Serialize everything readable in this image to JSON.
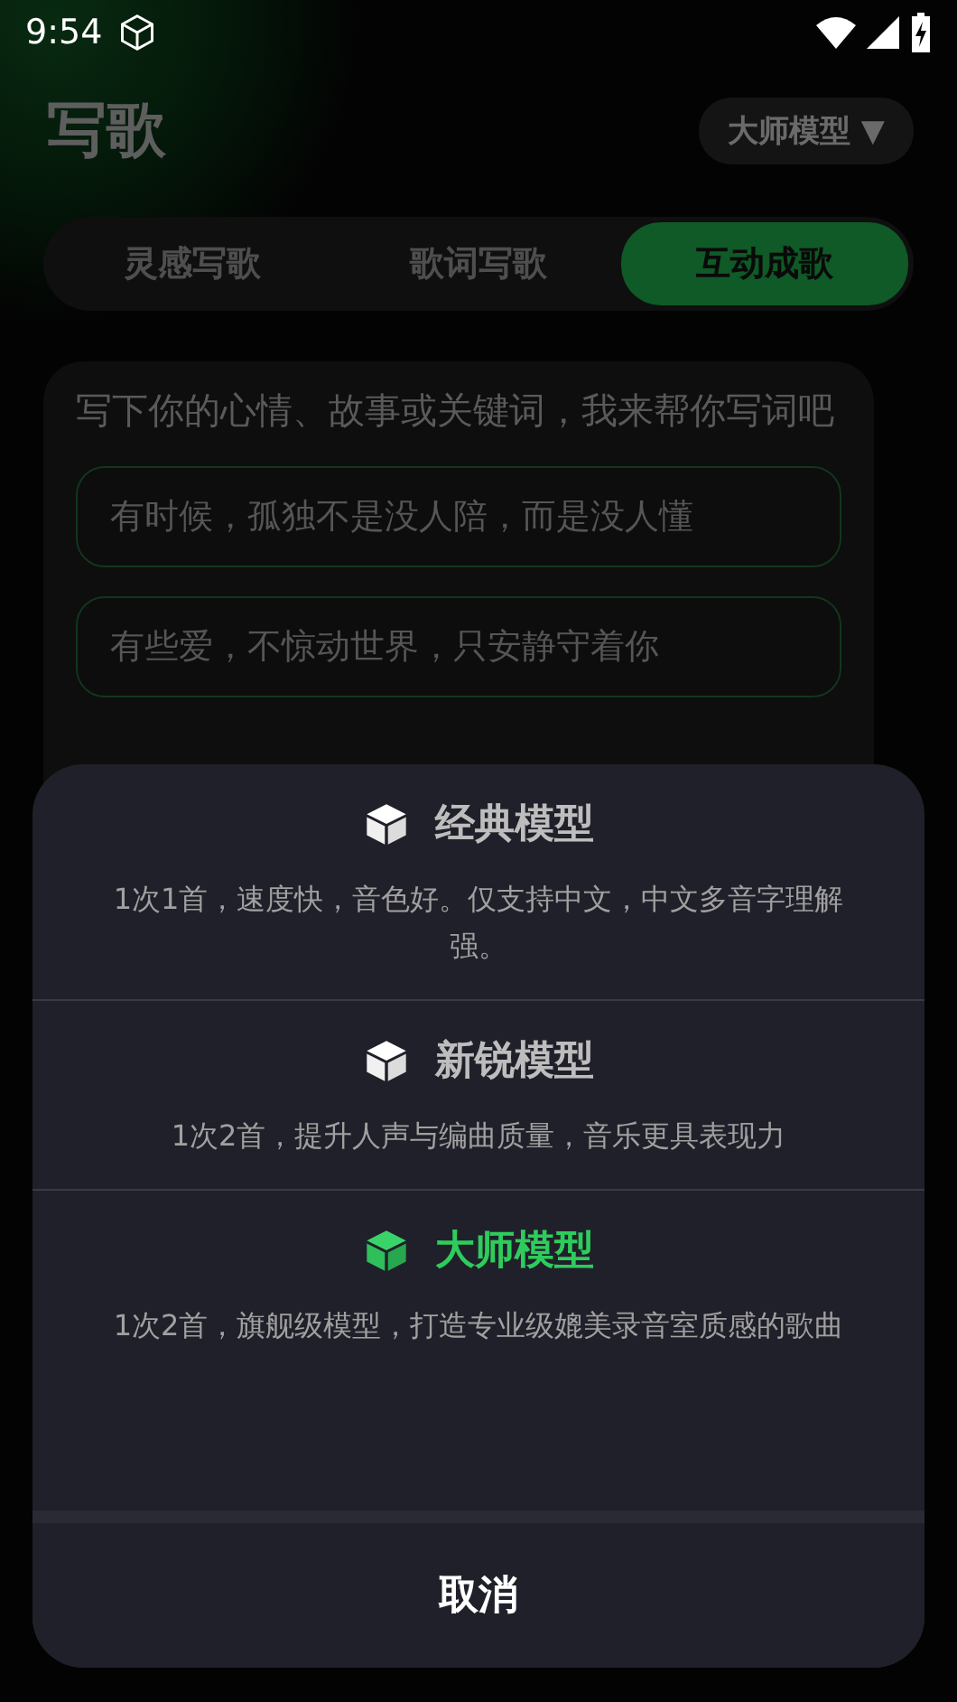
{
  "status_bar": {
    "time": "9:54"
  },
  "header": {
    "title": "写歌",
    "model_button": {
      "label": "大师模型",
      "caret": "▼"
    }
  },
  "tabs": [
    {
      "label": "灵感写歌",
      "selected": false
    },
    {
      "label": "歌词写歌",
      "selected": false
    },
    {
      "label": "互动成歌",
      "selected": true
    }
  ],
  "card": {
    "prompt": "写下你的心情、故事或关键词，我来帮你写词吧",
    "suggestions": [
      "有时候，孤独不是没人陪，而是没人懂",
      "有些爱，不惊动世界，只安静守着你"
    ]
  },
  "model_sheet": {
    "options": [
      {
        "title": "经典模型",
        "description": "1次1首，速度快，音色好。仅支持中文，中文多音字理解强。",
        "selected": false
      },
      {
        "title": "新锐模型",
        "description": "1次2首，提升人声与编曲质量，音乐更具表现力",
        "selected": false
      },
      {
        "title": "大师模型",
        "description": "1次2首，旗舰级模型，打造专业级媲美录音室质感的歌曲",
        "selected": true
      }
    ],
    "cancel": "取消"
  }
}
